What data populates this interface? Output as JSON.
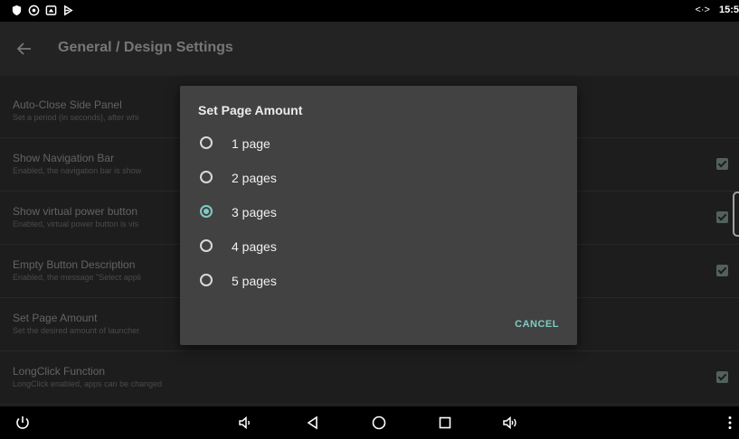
{
  "status_bar": {
    "icons": [
      "shield-icon",
      "eye-icon",
      "cast-icon",
      "play-store-icon"
    ],
    "signal": "<·>",
    "time": "15:5"
  },
  "app_bar": {
    "back_icon": "arrow-left-icon",
    "title": "General / Design Settings"
  },
  "settings": [
    {
      "title": "Auto-Close Side Panel",
      "subtitle": "Set a period (in seconds), after whi",
      "checked": false
    },
    {
      "title": "Show Navigation Bar",
      "subtitle": "Enabled, the navigation bar is show",
      "checked": true
    },
    {
      "title": "Show virtual power button",
      "subtitle": "Enabled, virtual power button is vis",
      "checked": true
    },
    {
      "title": "Empty Button Description",
      "subtitle": "Enabled, the message \"Select appli",
      "checked": true
    },
    {
      "title": "Set Page Amount",
      "subtitle": "Set the desired amount of launcher",
      "checked": false
    },
    {
      "title": "LongClick Function",
      "subtitle": "LongClick enabled, apps can be changed",
      "checked": true
    }
  ],
  "dialog": {
    "title": "Set Page Amount",
    "options": [
      {
        "label": "1 page",
        "selected": false
      },
      {
        "label": "2 pages",
        "selected": false
      },
      {
        "label": "3 pages",
        "selected": true
      },
      {
        "label": "4 pages",
        "selected": false
      },
      {
        "label": "5 pages",
        "selected": false
      }
    ],
    "cancel_label": "CANCEL"
  },
  "nav_bar": {
    "icons": [
      "power-icon",
      "volume-down-icon",
      "back-triangle-icon",
      "home-circle-icon",
      "recents-square-icon",
      "volume-up-icon",
      "more-vert-icon"
    ]
  },
  "colors": {
    "accent": "#7fcbc4",
    "dialog_bg": "#424242",
    "content_bg": "#232323",
    "app_bar_bg": "#2a2a2a"
  }
}
